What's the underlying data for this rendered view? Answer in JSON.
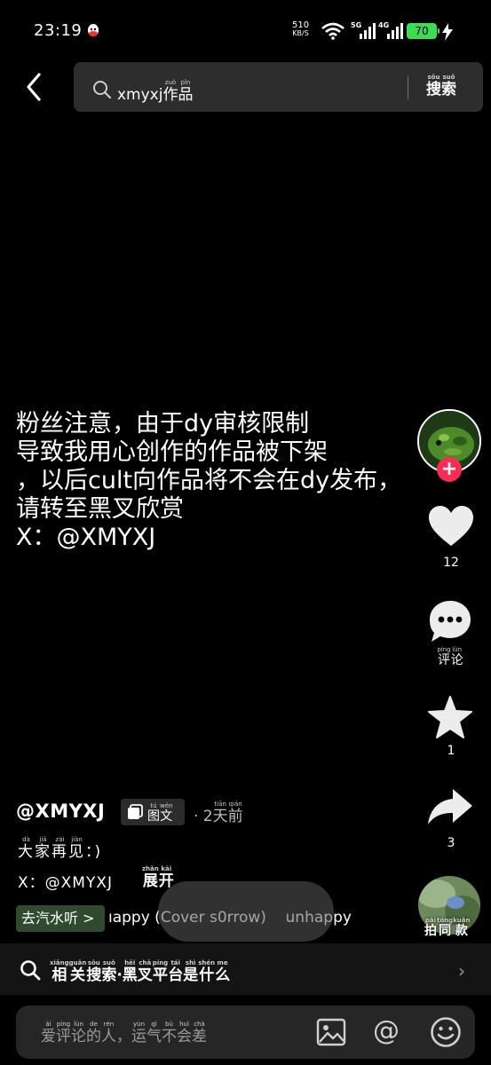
{
  "status_bar": {
    "time": "23:19",
    "net_speed_value": "510",
    "net_speed_unit": "KB/S",
    "sig1_label": "5G",
    "sig2_label": "4G",
    "battery": "70"
  },
  "search": {
    "query_prefix": "xmyxj",
    "query_suffix_chars": [
      {
        "c": "作",
        "p": "zuò"
      },
      {
        "c": "品",
        "p": "pǐn"
      }
    ],
    "button_chars": [
      {
        "c": "搜",
        "p": "sōu"
      },
      {
        "c": "索",
        "p": "suǒ"
      }
    ]
  },
  "caption": "粉丝注意，由于dy审核限制\n导致我用心创作的作品被下架\n，以后cult向作品将不会在dy发布，\n请转至黑叉欣赏\nX：@XMYXJ",
  "rail": {
    "like_count": "12",
    "comment_chars": [
      {
        "c": "评",
        "p": "píng"
      },
      {
        "c": "论",
        "p": "lùn"
      }
    ],
    "favorite_count": "1",
    "share_count": "3",
    "music_disc_chars": [
      {
        "c": "拍",
        "p": "pāi"
      },
      {
        "c": "同",
        "p": "tóng"
      },
      {
        "c": "款",
        "p": "kuǎn"
      }
    ],
    "follow_symbol": "+"
  },
  "author": {
    "handle": "@XMYXJ",
    "post_type_chars": [
      {
        "c": "图",
        "p": "tú"
      },
      {
        "c": "文",
        "p": "wén"
      }
    ],
    "time_prefix": "· 2",
    "time_chars": [
      {
        "c": "天",
        "p": "tiān"
      },
      {
        "c": "前",
        "p": "qián"
      }
    ]
  },
  "description": {
    "line1_chars": [
      {
        "c": "大",
        "p": "dà"
      },
      {
        "c": "家",
        "p": "jiā"
      },
      {
        "c": "再",
        "p": "zài"
      },
      {
        "c": "见",
        "p": "jiàn"
      },
      {
        "c": "：",
        "p": ""
      },
      {
        "c": ")",
        "p": ""
      }
    ],
    "line2_text": "X：@XMYXJ",
    "expand_chars": [
      {
        "c": "展",
        "p": "zhǎn"
      },
      {
        "c": "开",
        "p": "kāi"
      }
    ]
  },
  "music": {
    "app_button": "去汽水听 >",
    "title": "ıappy (Cover s0rrow)    unhappy"
  },
  "related": {
    "chars": [
      {
        "c": "相",
        "p": "xiāng"
      },
      {
        "c": "关",
        "p": "guān"
      },
      {
        "c": "搜",
        "p": "sōu"
      },
      {
        "c": "索",
        "p": "suǒ"
      },
      {
        "c": "·",
        "p": ""
      },
      {
        "c": "黑",
        "p": "hēi"
      },
      {
        "c": "叉",
        "p": "chā"
      },
      {
        "c": "平",
        "p": "píng"
      },
      {
        "c": "台",
        "p": "tái"
      },
      {
        "c": "是",
        "p": "shì"
      },
      {
        "c": "什",
        "p": "shén"
      },
      {
        "c": "么",
        "p": "me"
      }
    ],
    "chevron": "›"
  },
  "comment_box": {
    "placeholder_chars": [
      {
        "c": "爱",
        "p": "ài"
      },
      {
        "c": "评",
        "p": "píng"
      },
      {
        "c": "论",
        "p": "lùn"
      },
      {
        "c": "的",
        "p": "de"
      },
      {
        "c": "人",
        "p": "rén"
      },
      {
        "c": "，",
        "p": ""
      },
      {
        "c": "运",
        "p": "yùn"
      },
      {
        "c": "气",
        "p": "qì"
      },
      {
        "c": "不",
        "p": "bù"
      },
      {
        "c": "会",
        "p": "huì"
      },
      {
        "c": "差",
        "p": "chà"
      }
    ],
    "at_symbol": "@"
  },
  "colors": {
    "background": "#000000",
    "accent_follow": "#fe2c55",
    "battery": "#3ddc54",
    "music_app_button": "#2f4a2f"
  },
  "icons": [
    "back-icon",
    "search-icon",
    "heart-icon",
    "comment-icon",
    "star-icon",
    "share-icon",
    "image-icon",
    "at-icon",
    "emoji-icon",
    "wifi-icon",
    "qq-icon"
  ]
}
